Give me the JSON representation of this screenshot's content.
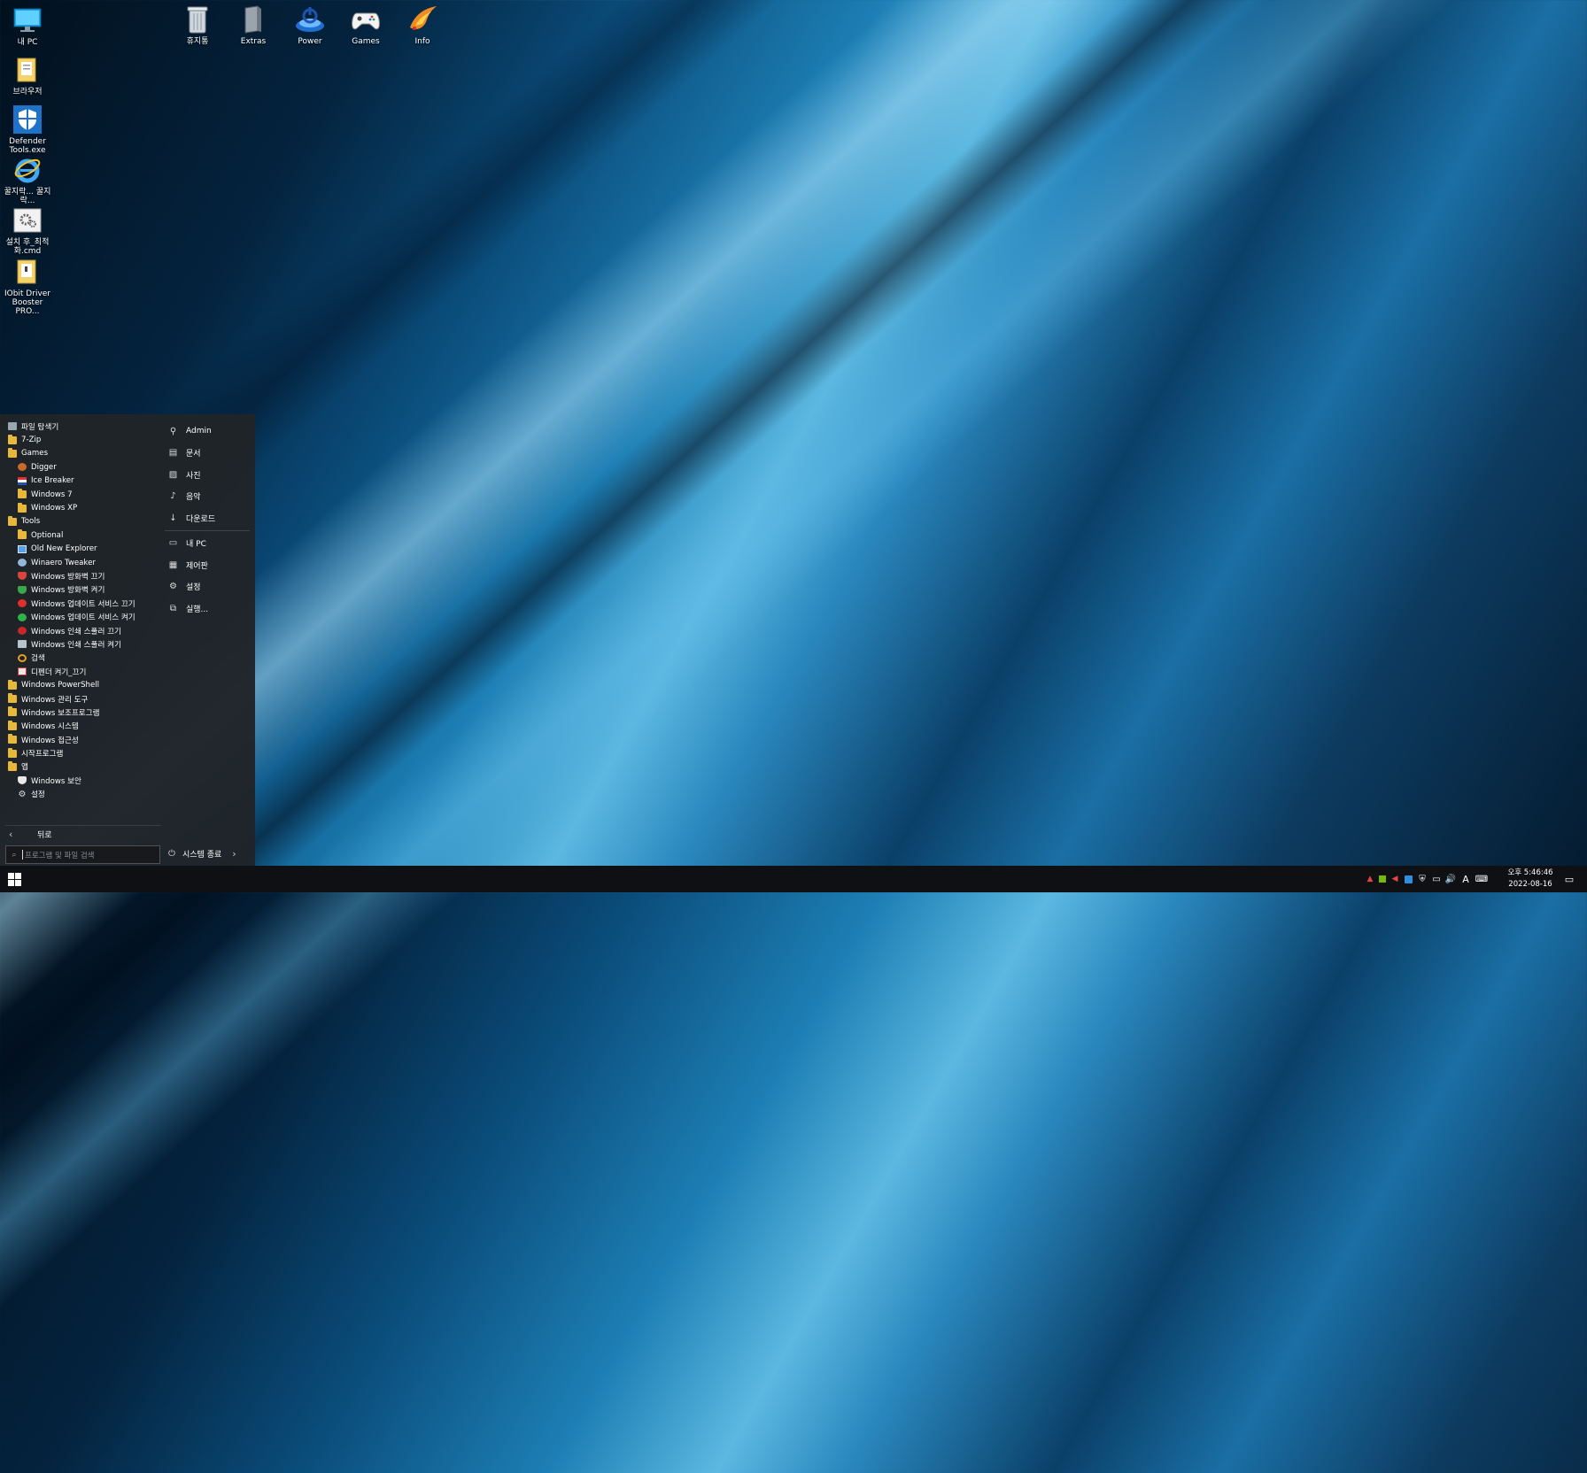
{
  "desktop_left": [
    {
      "label": "내 PC",
      "icon": "monitor-icon"
    },
    {
      "label": "브라우저",
      "icon": "folder-doc-icon"
    },
    {
      "label": "Defender Tools.exe",
      "icon": "shield-icon"
    },
    {
      "label": "꿀지락... 꿀지락...",
      "icon": "ie-icon"
    },
    {
      "label": "설치 후_최적화.cmd",
      "icon": "gear-file-icon"
    },
    {
      "label": "IObit Driver Booster PRO...",
      "icon": "folder-doc-icon"
    }
  ],
  "desktop_top": [
    {
      "label": "휴지통",
      "icon": "recycle-bin-icon"
    },
    {
      "label": "Extras",
      "icon": "book-icon"
    },
    {
      "label": "Power",
      "icon": "power-icon"
    },
    {
      "label": "Games",
      "icon": "gamepad-icon"
    },
    {
      "label": "Info",
      "icon": "bird-icon"
    }
  ],
  "start_menu": {
    "programs": [
      {
        "label": "파일 탐색기",
        "level": 0,
        "icon": "explorer-icon"
      },
      {
        "label": "7-Zip",
        "level": 0,
        "icon": "folder-icon"
      },
      {
        "label": "Games",
        "level": 0,
        "icon": "folder-icon"
      },
      {
        "label": "Digger",
        "level": 1,
        "icon": "digger-icon"
      },
      {
        "label": "Ice Breaker",
        "level": 1,
        "icon": "flag-icon"
      },
      {
        "label": "Windows 7",
        "level": 1,
        "icon": "folder-icon"
      },
      {
        "label": "Windows XP",
        "level": 1,
        "icon": "folder-icon"
      },
      {
        "label": "Tools",
        "level": 0,
        "icon": "folder-icon"
      },
      {
        "label": "Optional",
        "level": 1,
        "icon": "folder-icon"
      },
      {
        "label": "Old New Explorer",
        "level": 1,
        "icon": "window-icon"
      },
      {
        "label": "Winaero Tweaker",
        "level": 1,
        "icon": "tweaker-icon"
      },
      {
        "label": "Windows 방화벽 끄기",
        "level": 1,
        "icon": "shield-red-icon"
      },
      {
        "label": "Windows 방화벽 켜기",
        "level": 1,
        "icon": "shield-green-icon"
      },
      {
        "label": "Windows 업데이트 서비스 끄기",
        "level": 1,
        "icon": "x-circle-icon"
      },
      {
        "label": "Windows 업데이트 서비스 켜기",
        "level": 1,
        "icon": "check-circle-icon"
      },
      {
        "label": "Windows 인쇄 스풀러 끄기",
        "level": 1,
        "icon": "no-entry-icon"
      },
      {
        "label": "Windows 인쇄 스풀러 켜기",
        "level": 1,
        "icon": "printer-icon"
      },
      {
        "label": "검색",
        "level": 1,
        "icon": "search-icon"
      },
      {
        "label": "디펜더 켜기_끄기",
        "level": 1,
        "icon": "defender-icon"
      },
      {
        "label": "Windows PowerShell",
        "level": 0,
        "icon": "folder-icon"
      },
      {
        "label": "Windows 관리 도구",
        "level": 0,
        "icon": "folder-icon"
      },
      {
        "label": "Windows 보조프로그램",
        "level": 0,
        "icon": "folder-icon"
      },
      {
        "label": "Windows 시스템",
        "level": 0,
        "icon": "folder-icon"
      },
      {
        "label": "Windows 접근성",
        "level": 0,
        "icon": "folder-icon"
      },
      {
        "label": "시작프로그램",
        "level": 0,
        "icon": "folder-icon"
      },
      {
        "label": "앱",
        "level": 0,
        "icon": "folder-icon"
      },
      {
        "label": "Windows 보안",
        "level": 1,
        "icon": "shield-white-icon"
      },
      {
        "label": "설정",
        "level": 1,
        "icon": "gear-icon"
      }
    ],
    "right_top": [
      {
        "label": "Admin",
        "icon": "user-icon"
      },
      {
        "label": "문서",
        "icon": "document-icon"
      },
      {
        "label": "사진",
        "icon": "picture-icon"
      },
      {
        "label": "음악",
        "icon": "music-icon"
      },
      {
        "label": "다운로드",
        "icon": "download-icon"
      }
    ],
    "right_bottom": [
      {
        "label": "내 PC",
        "icon": "monitor-icon"
      },
      {
        "label": "제어판",
        "icon": "control-panel-icon"
      },
      {
        "label": "설정",
        "icon": "gear-icon"
      },
      {
        "label": "실행...",
        "icon": "run-icon"
      }
    ],
    "back_label": "뒤로",
    "search_placeholder": "프로그램 및 파일 검색",
    "shutdown_label": "시스템 종료"
  },
  "taskbar": {
    "clock_time": "오후 5:46:46",
    "clock_date": "2022-08-16",
    "ime_label": "A",
    "tray_icons": [
      "tray-chevron-icon",
      "nvidia-icon",
      "volume-mute-icon",
      "bluetooth-icon",
      "windows-security-icon",
      "network-icon",
      "speaker-icon"
    ]
  }
}
